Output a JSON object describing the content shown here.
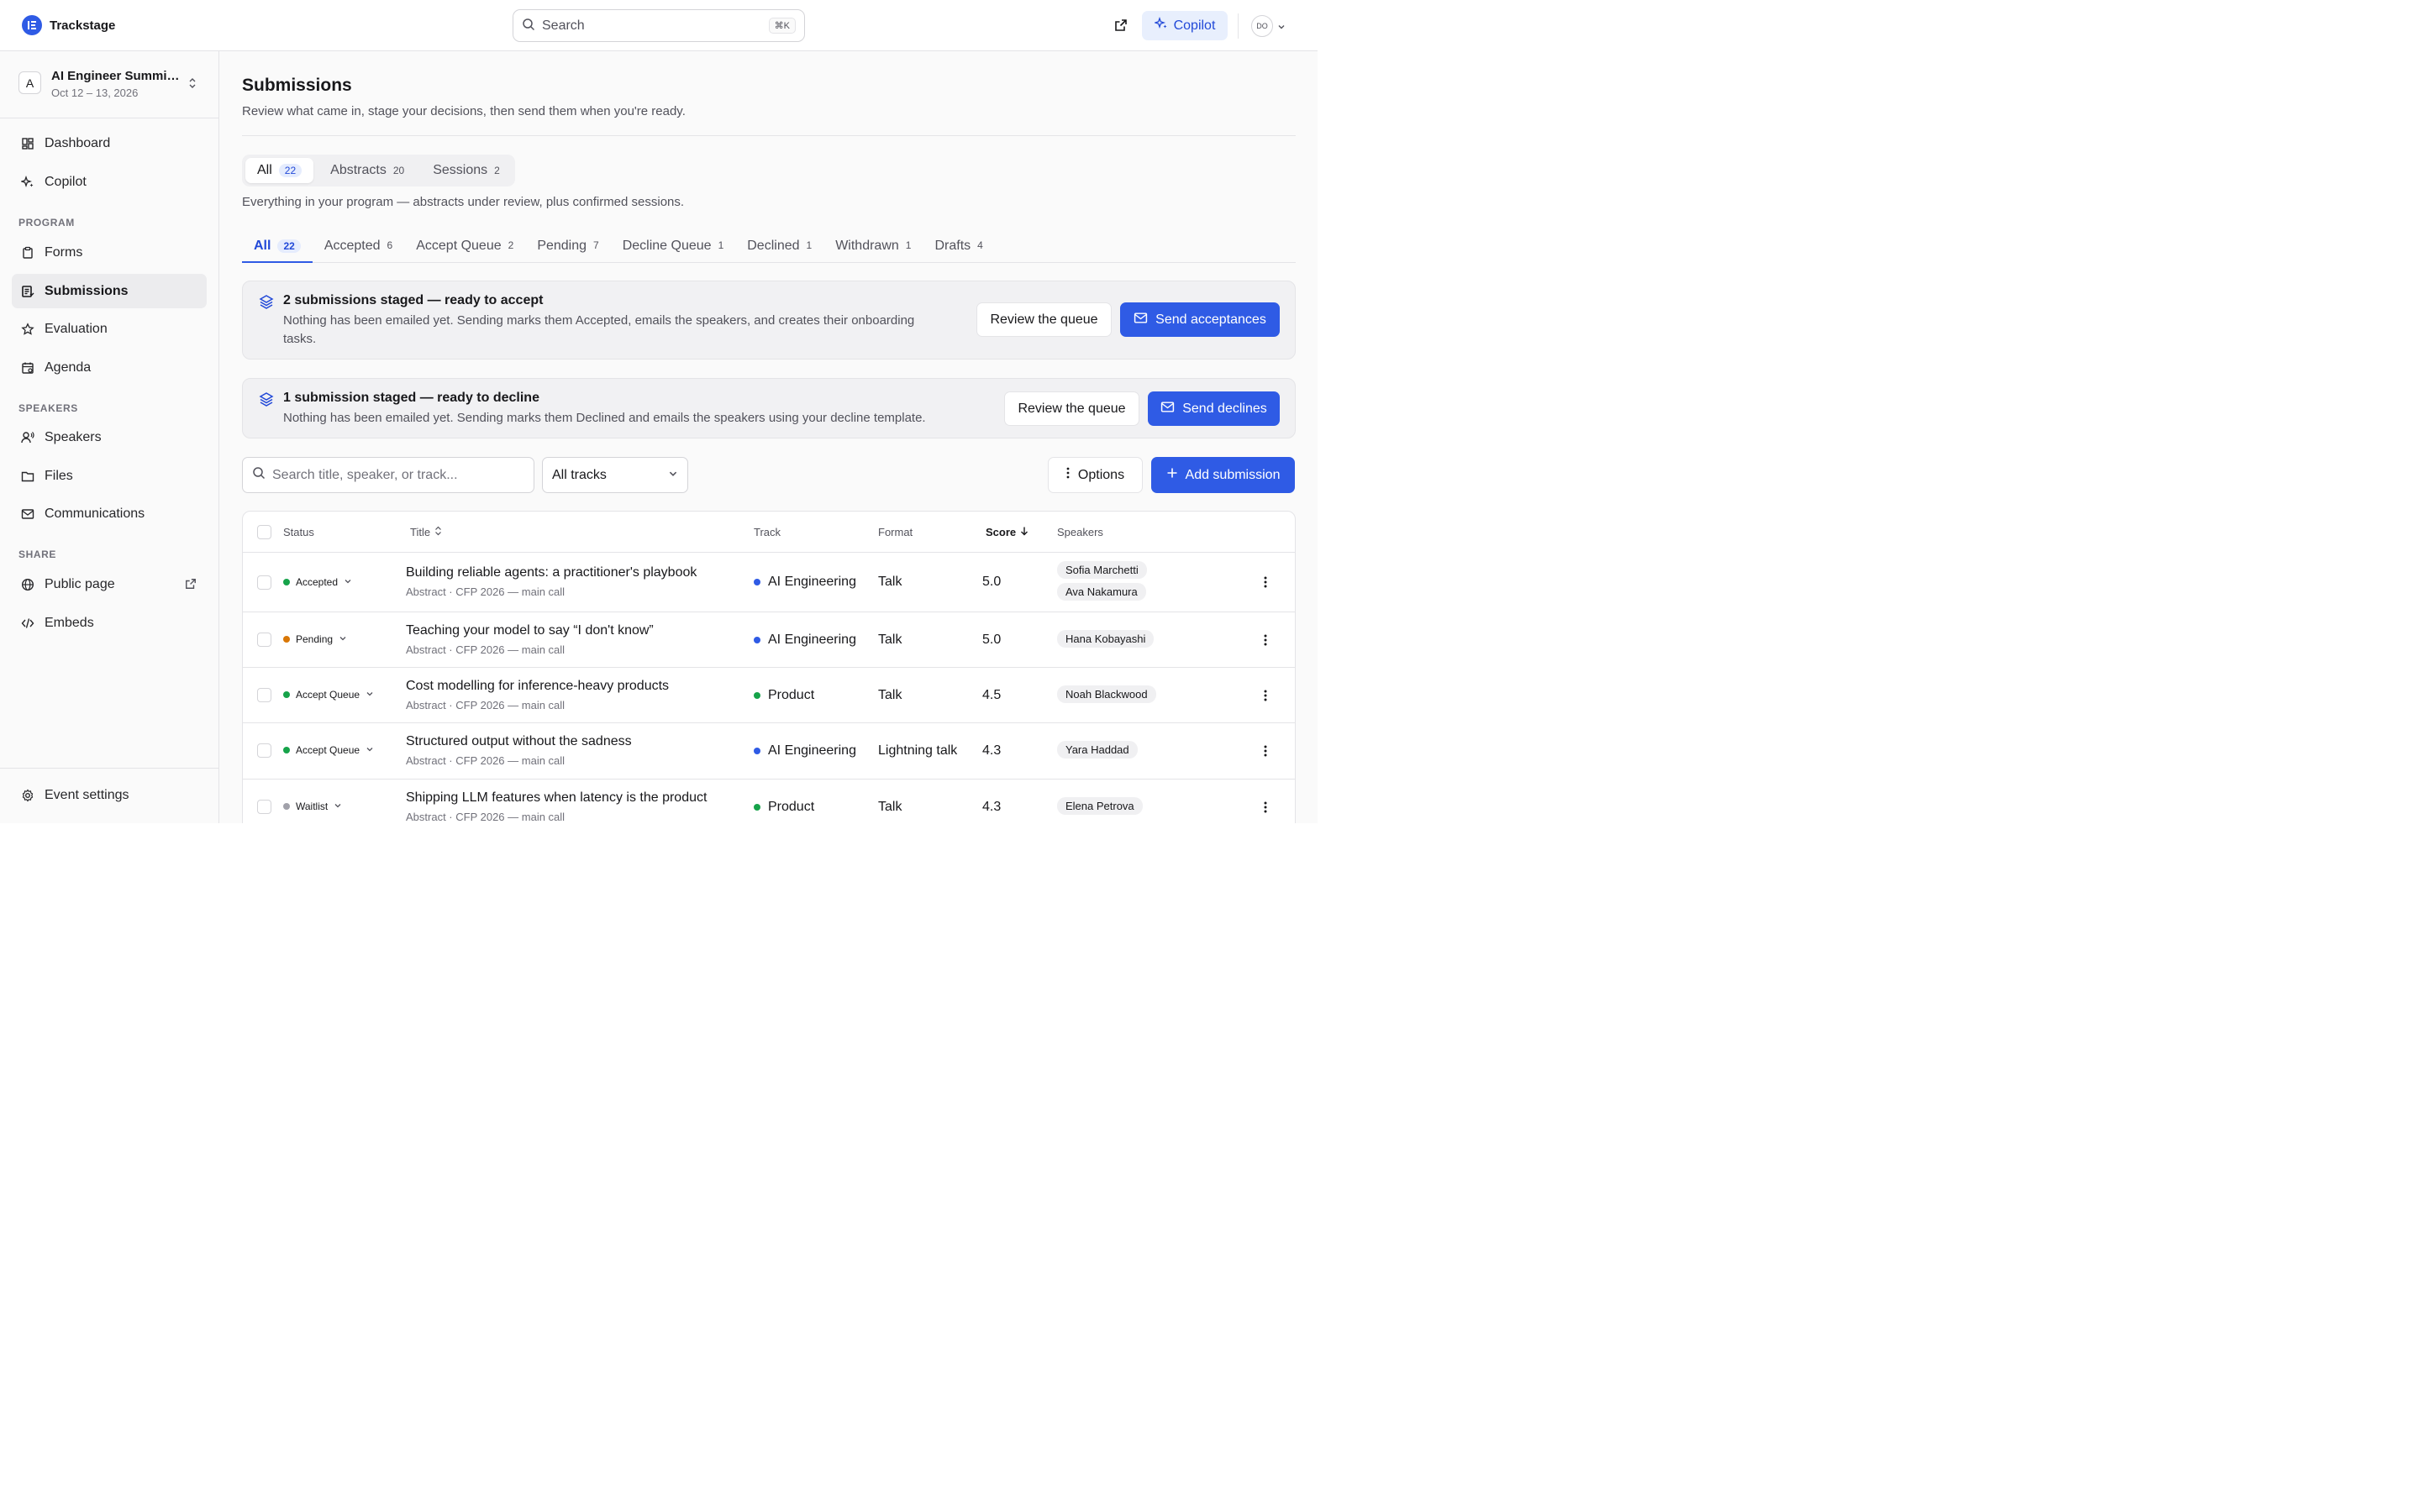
{
  "app": {
    "name": "Trackstage",
    "search_placeholder": "Search",
    "search_shortcut": "⌘K",
    "copilot_label": "Copilot",
    "user_initials": "DO"
  },
  "event": {
    "badge": "A",
    "name": "AI Engineer Summit 2026",
    "dates": "Oct 12 – 13, 2026"
  },
  "nav": {
    "dashboard": "Dashboard",
    "copilot": "Copilot",
    "section_program": "PROGRAM",
    "forms": "Forms",
    "submissions": "Submissions",
    "evaluation": "Evaluation",
    "agenda": "Agenda",
    "section_speakers": "SPEAKERS",
    "speakers": "Speakers",
    "files": "Files",
    "communications": "Communications",
    "section_share": "SHARE",
    "public_page": "Public page",
    "embeds": "Embeds",
    "event_settings": "Event settings"
  },
  "page": {
    "title": "Submissions",
    "subtitle": "Review what came in, stage your decisions, then send them when you're ready."
  },
  "segments": [
    {
      "label": "All",
      "count": "22"
    },
    {
      "label": "Abstracts",
      "count": "20"
    },
    {
      "label": "Sessions",
      "count": "2"
    }
  ],
  "segment_description": "Everything in your program — abstracts under review, plus confirmed sessions.",
  "tabs": [
    {
      "label": "All",
      "count": "22"
    },
    {
      "label": "Accepted",
      "count": "6"
    },
    {
      "label": "Accept Queue",
      "count": "2"
    },
    {
      "label": "Pending",
      "count": "7"
    },
    {
      "label": "Decline Queue",
      "count": "1"
    },
    {
      "label": "Declined",
      "count": "1"
    },
    {
      "label": "Withdrawn",
      "count": "1"
    },
    {
      "label": "Drafts",
      "count": "4"
    }
  ],
  "banners": {
    "accept": {
      "title": "2 submissions staged — ready to accept",
      "body": "Nothing has been emailed yet. Sending marks them Accepted, emails the speakers, and creates their onboarding tasks.",
      "review_label": "Review the queue",
      "send_label": "Send acceptances"
    },
    "decline": {
      "title": "1 submission staged — ready to decline",
      "body": "Nothing has been emailed yet. Sending marks them Declined and emails the speakers using your decline template.",
      "review_label": "Review the queue",
      "send_label": "Send declines"
    }
  },
  "filters": {
    "search_placeholder": "Search title, speaker, or track...",
    "track_value": "All tracks",
    "options_label": "Options",
    "add_label": "Add submission"
  },
  "table": {
    "headers": {
      "status": "Status",
      "title": "Title",
      "track": "Track",
      "format": "Format",
      "score": "Score",
      "speakers": "Speakers"
    },
    "rows": [
      {
        "status": "Accepted",
        "status_color": "#16a34a",
        "title": "Building reliable agents: a practitioner's playbook",
        "meta": "Abstract · CFP 2026 — main call",
        "track": "AI Engineering",
        "track_color": "#2f5be5",
        "format": "Talk",
        "score": "5.0",
        "speakers": [
          "Sofia Marchetti",
          "Ava Nakamura"
        ]
      },
      {
        "status": "Pending",
        "status_color": "#d97706",
        "title": "Teaching your model to say “I don't know”",
        "meta": "Abstract · CFP 2026 — main call",
        "track": "AI Engineering",
        "track_color": "#2f5be5",
        "format": "Talk",
        "score": "5.0",
        "speakers": [
          "Hana Kobayashi"
        ]
      },
      {
        "status": "Accept Queue",
        "status_color": "#16a34a",
        "title": "Cost modelling for inference-heavy products",
        "meta": "Abstract · CFP 2026 — main call",
        "track": "Product",
        "track_color": "#16a34a",
        "format": "Talk",
        "score": "4.5",
        "speakers": [
          "Noah Blackwood"
        ]
      },
      {
        "status": "Accept Queue",
        "status_color": "#16a34a",
        "title": "Structured output without the sadness",
        "meta": "Abstract · CFP 2026 — main call",
        "track": "AI Engineering",
        "track_color": "#2f5be5",
        "format": "Lightning talk",
        "score": "4.3",
        "speakers": [
          "Yara Haddad"
        ]
      },
      {
        "status": "Waitlist",
        "status_color": "#a1a1aa",
        "title": "Shipping LLM features when latency is the product",
        "meta": "Abstract · CFP 2026 — main call",
        "track": "Product",
        "track_color": "#16a34a",
        "format": "Talk",
        "score": "4.3",
        "speakers": [
          "Elena Petrova"
        ]
      }
    ]
  },
  "colors": {
    "accent": "#2f5be5",
    "accent_soft": "#e8effd",
    "sidebar_bg": "#fafafa"
  }
}
